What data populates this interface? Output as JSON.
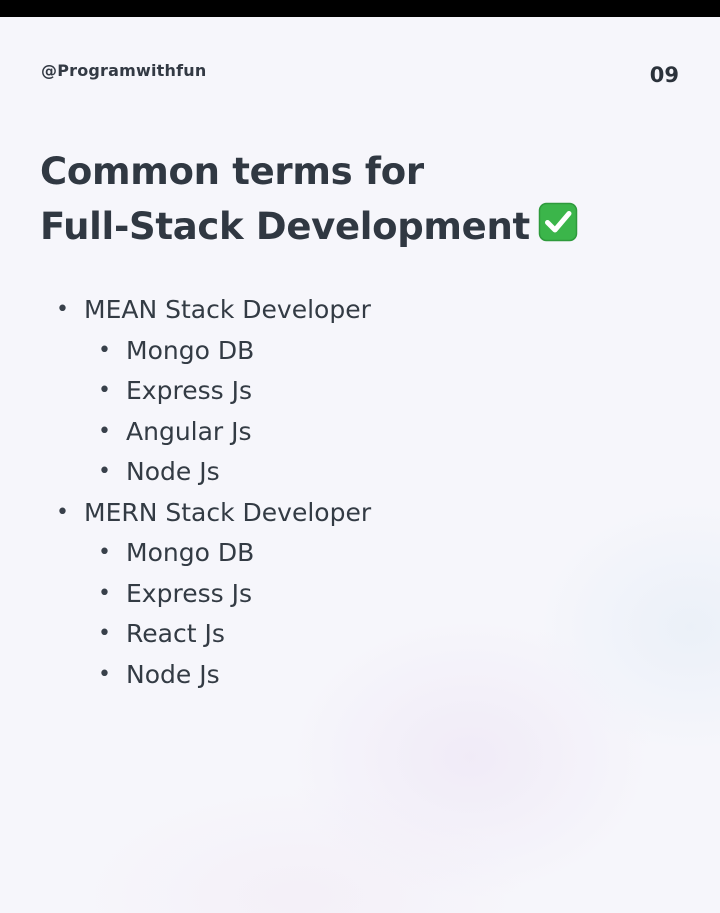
{
  "header": {
    "handle": "@Programwithfun",
    "page_number": "09"
  },
  "title": {
    "line1": "Common terms for",
    "line2": "Full-Stack Development",
    "icon": "check-mark-button-icon",
    "icon_color": "#3bb54a"
  },
  "bullet_char": "•",
  "stacks": [
    {
      "label": "MEAN Stack Developer",
      "items": [
        "Mongo DB",
        "Express Js",
        "Angular Js",
        "Node Js"
      ]
    },
    {
      "label": "MERN Stack Developer",
      "items": [
        "Mongo DB",
        "Express Js",
        "React Js",
        "Node Js"
      ]
    }
  ]
}
